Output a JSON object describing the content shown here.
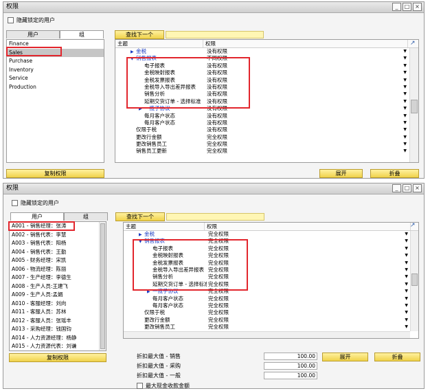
{
  "win1": {
    "title": "权限",
    "hide_locked_label": "隐藏锁定的用户",
    "tabs": [
      "用户",
      "组"
    ],
    "groups": [
      "Finance",
      "Sales",
      "Purchase",
      "Inventory",
      "Service",
      "Production"
    ],
    "copy_button": "复制权限",
    "find_button": "查找下一个",
    "header": {
      "subject": "主题",
      "permission": "权限"
    },
    "rows": [
      {
        "subject": "金税",
        "perm": "没有权限",
        "blue": true,
        "tri": "▶"
      },
      {
        "subject": "销售报表",
        "perm": "不同权限",
        "blue": true,
        "tri": "▼"
      },
      {
        "subject": "电子报表",
        "perm": "没有权限"
      },
      {
        "subject": "金税映射报表",
        "perm": "没有权限"
      },
      {
        "subject": "金税发票报表",
        "perm": "没有权限"
      },
      {
        "subject": "金税导入导出差异报表",
        "perm": "没有权限"
      },
      {
        "subject": "销售分析",
        "perm": "没有权限"
      },
      {
        "subject": "延期交货订单 - 选择标准",
        "perm": "没有权限"
      },
      {
        "subject": "一揽子协议",
        "perm": "没有权限",
        "blue": true,
        "tri": "▶"
      },
      {
        "subject": "每月客户状态",
        "perm": "没有权限"
      },
      {
        "subject": "每月客户状态",
        "perm": "没有权限"
      },
      {
        "subject": "仅限于税",
        "perm": "没有权限"
      },
      {
        "subject": "更改行金额",
        "perm": "完全权限"
      },
      {
        "subject": "更改销售员工",
        "perm": "完全权限"
      },
      {
        "subject": "销售员工更新",
        "perm": "完全权限"
      }
    ],
    "expand_button": "展开",
    "collapse_button": "折叠"
  },
  "win2": {
    "title": "权限",
    "hide_locked_label": "隐藏锁定的用户",
    "tabs": [
      "用户",
      "组"
    ],
    "users": [
      "A001 - 销售经理：张涛",
      "A002 - 销售代表：李慧",
      "A003 - 销售代表：阳杨",
      "A004 - 销售代表：王勤",
      "A005 - 财务经理：宋凯",
      "A006 - 物流经理：陈丽",
      "A007 - 生产经理：李德生",
      "A008 - 生产人员:王建飞",
      "A009 - 生产人员:孟娟",
      "A010 - 客服经理：刘向",
      "A011 - 客服人员：苏林",
      "A012 - 客服人员：张瑶丰",
      "A013 - 采购经理：钱国钧",
      "A014 - 人力资源经理：杨静",
      "A015 - 人力资源代表：刘谦"
    ],
    "copy_button": "复制权限",
    "find_button": "查找下一个",
    "header": {
      "subject": "主题",
      "permission": "权限"
    },
    "rows": [
      {
        "subject": "金税",
        "perm": "完全权限",
        "blue": true,
        "tri": "▶"
      },
      {
        "subject": "销售报表",
        "perm": "完全权限",
        "blue": true,
        "tri": "▼"
      },
      {
        "subject": "电子报表",
        "perm": "完全权限"
      },
      {
        "subject": "金税映射报表",
        "perm": "完全权限"
      },
      {
        "subject": "金税发票报表",
        "perm": "完全权限"
      },
      {
        "subject": "金税导入导出差异报表",
        "perm": "完全权限"
      },
      {
        "subject": "销售分析",
        "perm": "完全权限"
      },
      {
        "subject": "延期交货订单 - 选择标准",
        "perm": "完全权限"
      },
      {
        "subject": "一揽子协议",
        "perm": "完全权限",
        "blue": true,
        "tri": "▶"
      },
      {
        "subject": "每月客户状态",
        "perm": "完全权限"
      },
      {
        "subject": "每月客户状态",
        "perm": "完全权限"
      },
      {
        "subject": "仅限于税",
        "perm": "完全权限"
      },
      {
        "subject": "更改行金额",
        "perm": "完全权限"
      },
      {
        "subject": "更改销售员工",
        "perm": "完全权限"
      }
    ],
    "discounts": [
      {
        "label": "折扣最大值 - 销售",
        "value": "100.00"
      },
      {
        "label": "折扣最大值 - 采购",
        "value": "100.00"
      },
      {
        "label": "折扣最大值 - 一般",
        "value": "100.00"
      }
    ],
    "max_cash_label": "最大现金收款金额",
    "expand_button": "展开",
    "collapse_button": "折叠"
  },
  "colors": {
    "accent_yellow": "#f0d24a",
    "highlight_red": "#e2252c",
    "link_blue": "#1538c2"
  }
}
